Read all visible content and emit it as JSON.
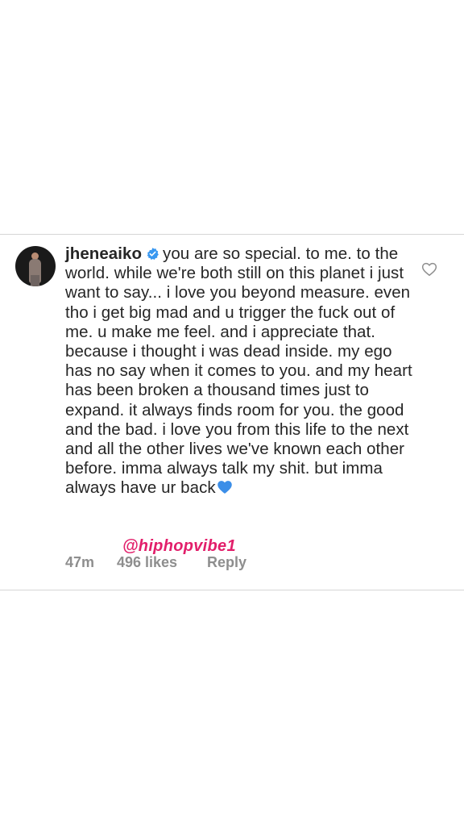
{
  "comment": {
    "username": "jheneaiko",
    "verified_icon": "verified-badge-icon",
    "text": "you are so special. to me. to the world. while we're both still on this planet i just want to say... i love you beyond measure. even tho i get big mad and u trigger the fuck out of me. u make me feel. and i appreciate that. because i thought i was dead inside. my ego has no say when it comes to you. and my heart has been broken a thousand times just to expand. it always finds room for you. the good and the bad. i love you from this life to the next and all the other lives we've known each other before. imma always talk my shit. but imma always have ur back",
    "emoji_icon": "blue-heart-icon",
    "time": "47m",
    "likes": "496 likes",
    "reply_label": "Reply",
    "like_icon": "heart-outline-icon"
  },
  "watermark": {
    "text": "@hiphopvibe1",
    "color": "#e21e6a"
  },
  "colors": {
    "verified_blue": "#3897f0",
    "heart_blue": "#3b8ee8",
    "meta_gray": "#8e8e8e"
  }
}
